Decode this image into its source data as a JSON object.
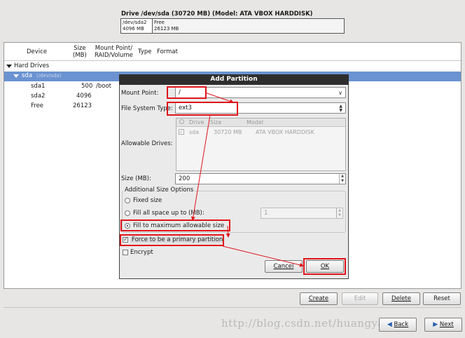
{
  "drive": {
    "title": "Drive /dev/sda (30720 MB) (Model: ATA VBOX HARDDISK)",
    "segments": [
      {
        "name": "/dev/sda2",
        "size": "4096 MB"
      },
      {
        "name": "Free",
        "size": "26123 MB"
      }
    ]
  },
  "table": {
    "headers": {
      "device": "Device",
      "size_line1": "Size",
      "size_line2": "(MB)",
      "mount_line1": "Mount Point/",
      "mount_line2": "RAID/Volume",
      "type": "Type",
      "format": "Format"
    },
    "hard_drives_label": "Hard Drives",
    "sda_label": "sda",
    "sda_path": "(/dev/sda)",
    "rows": [
      {
        "device": "sda1",
        "size": "500",
        "mount": "/boot"
      },
      {
        "device": "sda2",
        "size": "4096",
        "mount": ""
      },
      {
        "device": "Free",
        "size": "26123",
        "mount": ""
      }
    ]
  },
  "dialog": {
    "title": "Add Partition",
    "mount_point_label": "Mount Point:",
    "mount_point_value": "/",
    "fs_type_label": "File System Type:",
    "fs_type_value": "ext3",
    "allowable_drives_label": "Allowable Drives:",
    "drives_columns": [
      "Drive",
      "Size",
      "Model"
    ],
    "drives_rows": [
      {
        "drive": "sda",
        "size": "30720 MB",
        "model": "ATA VBOX HARDDISK"
      }
    ],
    "size_label": "Size (MB):",
    "size_value": "200",
    "additional_size_label": "Additional Size Options",
    "fixed_size_label": "Fixed size",
    "fill_upto_label": "Fill all space up to (MB):",
    "fill_upto_value": "1",
    "fill_max_label": "Fill to maximum allowable size",
    "force_primary_label": "Force to be a primary partition",
    "encrypt_label": "Encrypt",
    "cancel_label": "Cancel",
    "ok_label": "OK"
  },
  "buttons": {
    "create": "Create",
    "edit": "Edit",
    "delete": "Delete",
    "reset": "Reset",
    "back": "Back",
    "next": "Next"
  },
  "watermark": "http://blog.csdn.net/huangyan",
  "colors": {
    "selection": "#6b93d1",
    "highlight": "#e0141b",
    "dialog_title_bg": "#2e2e2e"
  }
}
